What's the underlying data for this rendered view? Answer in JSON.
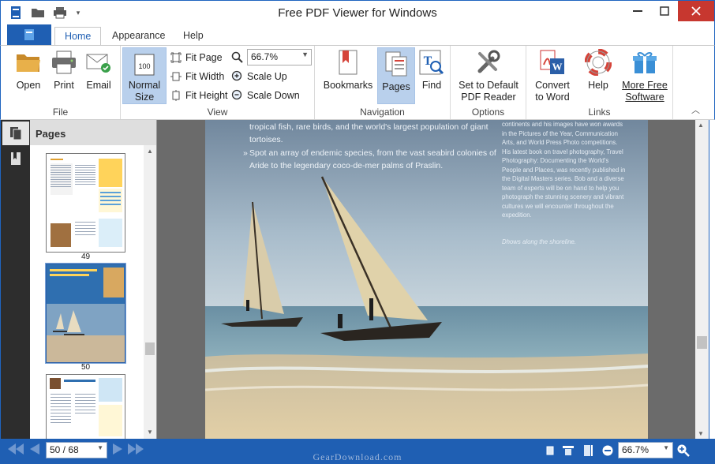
{
  "window": {
    "title": "Free PDF Viewer for Windows"
  },
  "tabs": [
    {
      "label": "Home"
    },
    {
      "label": "Appearance"
    },
    {
      "label": "Help"
    }
  ],
  "ribbon": {
    "file": {
      "label": "File",
      "open": "Open",
      "print": "Print",
      "email": "Email"
    },
    "view": {
      "label": "View",
      "normal_size_line1": "Normal",
      "normal_size_line2": "Size",
      "fit_page": "Fit Page",
      "fit_width": "Fit Width",
      "fit_height": "Fit Height",
      "zoom_value": "66.7%",
      "scale_up": "Scale Up",
      "scale_down": "Scale Down"
    },
    "navigation": {
      "label": "Navigation",
      "bookmarks": "Bookmarks",
      "pages": "Pages",
      "find": "Find"
    },
    "options": {
      "label": "Options",
      "default_line1": "Set to Default",
      "default_line2": "PDF Reader"
    },
    "links": {
      "label": "Links",
      "convert_line1": "Convert",
      "convert_line2": "to Word",
      "help": "Help",
      "more_line1": "More Free",
      "more_line2": "Software"
    }
  },
  "pages_panel": {
    "title": "Pages",
    "thumbnails": [
      {
        "number": "49"
      },
      {
        "number": "50"
      }
    ]
  },
  "document": {
    "bullet1_line1": "tropical fish, rare birds, and the world's largest population of giant",
    "bullet1_line2": "tortoises.",
    "bullet2_line1": "Spot an array of endemic species, from the vast seabird colonies of",
    "bullet2_line2": "Aride to the legendary coco-de-mer palms of Praslin.",
    "side_text": [
      "continents and his images have won awards",
      "in the Pictures of the Year, Communication",
      "Arts, and World Press Photo competitions.",
      "His latest book on travel photography, Travel",
      "Photography: Documenting the World's",
      "People and Places, was recently published in",
      "the Digital Masters series. Bob and a diverse",
      "team of experts will be on hand to help you",
      "photograph the stunning scenery and vibrant",
      "cultures we will encounter throughout the",
      "expedition."
    ],
    "caption": "Dhows along the shoreline."
  },
  "statusbar": {
    "page_indicator": "50 / 68",
    "zoom": "66.7%",
    "watermark": "GearDownload.com"
  },
  "colors": {
    "accent": "#1f5fb3",
    "pressed": "#b9d0ec",
    "sidebar_dark": "#2d2d2d",
    "doc_background": "#6b6b6b"
  }
}
